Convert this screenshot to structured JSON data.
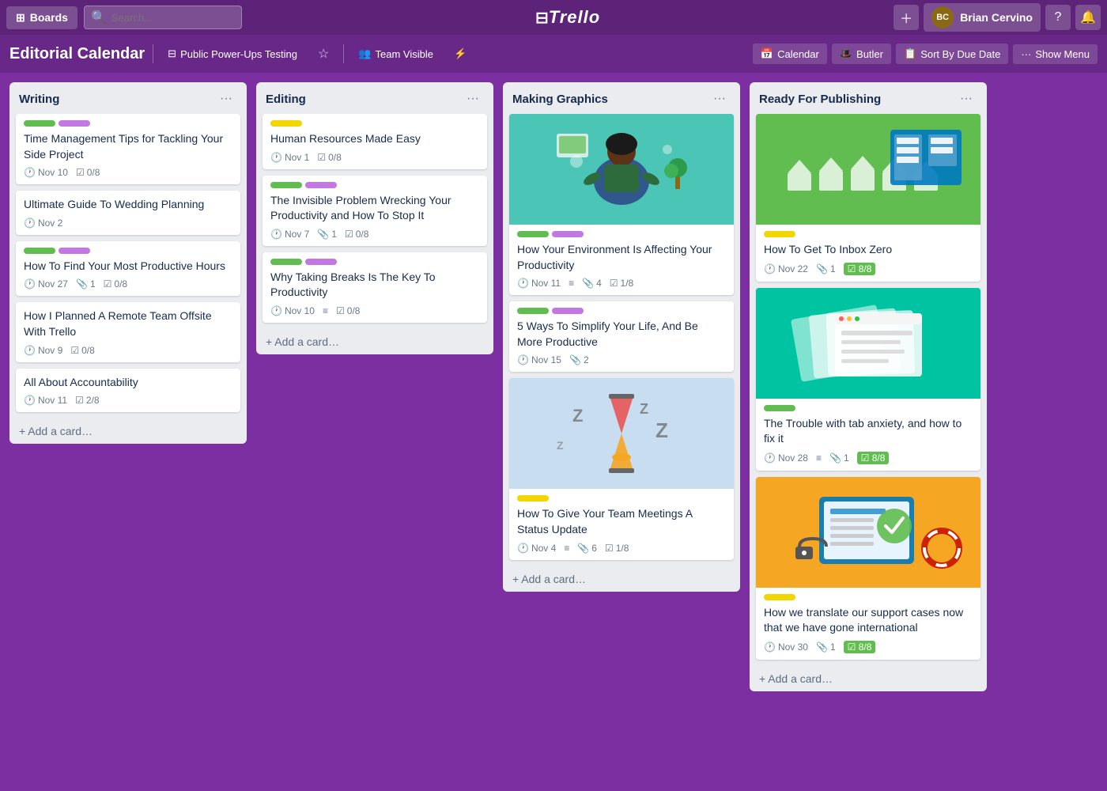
{
  "topnav": {
    "boards_label": "Boards",
    "search_placeholder": "Search...",
    "logo_text": "Trello",
    "user_name": "Brian Cervino",
    "user_initials": "BC"
  },
  "board": {
    "title": "Editorial Calendar",
    "workspace": "Public Power-Ups Testing",
    "visibility": "Team Visible",
    "actions": {
      "calendar": "Calendar",
      "butler": "Butler",
      "sort": "Sort By Due Date",
      "menu": "Show Menu"
    }
  },
  "lists": [
    {
      "id": "writing",
      "title": "Writing",
      "cards": [
        {
          "labels": [
            "green",
            "purple"
          ],
          "title": "Time Management Tips for Tackling Your Side Project",
          "due": "Nov 10",
          "checklist": "0/8",
          "has_image": false
        },
        {
          "labels": [],
          "title": "Ultimate Guide To Wedding Planning",
          "due": "Nov 2",
          "checklist": null,
          "has_image": false
        },
        {
          "labels": [
            "green",
            "purple"
          ],
          "title": "How To Find Your Most Productive Hours",
          "due": "Nov 27",
          "attachments": "1",
          "checklist": "0/8",
          "has_image": false
        },
        {
          "labels": [],
          "title": "How I Planned A Remote Team Offsite With Trello",
          "due": "Nov 9",
          "checklist": "0/8",
          "has_image": false
        },
        {
          "labels": [],
          "title": "All About Accountability",
          "due": "Nov 11",
          "checklist": "2/8",
          "has_image": false
        }
      ],
      "add_card": "Add a card…"
    },
    {
      "id": "editing",
      "title": "Editing",
      "cards": [
        {
          "labels": [
            "yellow"
          ],
          "title": "Human Resources Made Easy",
          "due": "Nov 1",
          "checklist": "0/8",
          "has_image": false
        },
        {
          "labels": [
            "green",
            "purple"
          ],
          "title": "The Invisible Problem Wrecking Your Productivity and How To Stop It",
          "due": "Nov 7",
          "attachments": "1",
          "checklist": "0/8",
          "has_image": false
        },
        {
          "labels": [
            "green",
            "purple"
          ],
          "title": "Why Taking Breaks Is The Key To Productivity",
          "due": "Nov 10",
          "description": true,
          "checklist": "0/8",
          "has_image": false
        }
      ],
      "add_card": "Add a card…"
    },
    {
      "id": "making-graphics",
      "title": "Making Graphics",
      "cards": [
        {
          "labels": [
            "green",
            "purple"
          ],
          "title": "How Your Environment Is Affecting Your Productivity",
          "due": "Nov 11",
          "description": true,
          "attachments": "4",
          "checklist": "1/8",
          "has_image": true,
          "image_type": "teal-woman"
        },
        {
          "labels": [
            "green",
            "purple"
          ],
          "title": "5 Ways To Simplify Your Life, And Be More Productive",
          "due": "Nov 15",
          "attachments": "2",
          "has_image": false
        },
        {
          "labels": [
            "yellow"
          ],
          "title": "How To Give Your Team Meetings A Status Update",
          "due": "Nov 4",
          "description": true,
          "attachments": "6",
          "checklist": "1/8",
          "has_image": true,
          "image_type": "hourglass"
        }
      ],
      "add_card": "Add a card…"
    },
    {
      "id": "ready-for-publishing",
      "title": "Ready For Publishing",
      "cards": [
        {
          "labels": [
            "yellow"
          ],
          "title": "How To Get To Inbox Zero",
          "due": "Nov 22",
          "attachments": "1",
          "checklist": "8/8",
          "checklist_done": true,
          "has_image": true,
          "image_type": "inbox-green"
        },
        {
          "labels": [
            "green"
          ],
          "title": "The Trouble with tab anxiety, and how to fix it",
          "due": "Nov 28",
          "description": true,
          "attachments": "1",
          "checklist": "8/8",
          "checklist_done": true,
          "has_image": true,
          "image_type": "tabs-green"
        },
        {
          "labels": [
            "yellow"
          ],
          "title": "How we translate our support cases now that we have gone international",
          "due": "Nov 30",
          "attachments": "1",
          "checklist": "8/8",
          "checklist_done": true,
          "has_image": true,
          "image_type": "support-orange"
        }
      ],
      "add_card": "Add a card…"
    }
  ]
}
